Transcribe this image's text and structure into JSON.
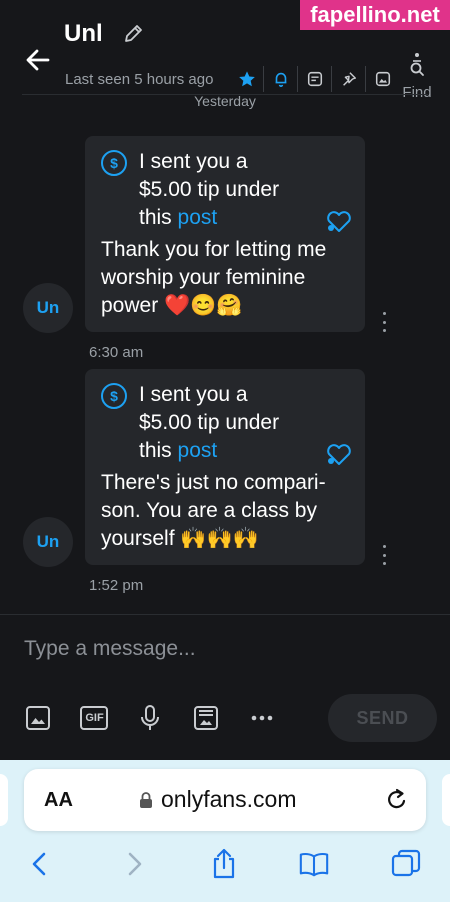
{
  "watermark": "fapellino.net",
  "header": {
    "name": "Unl",
    "last_seen": "Last seen 5 hours ago",
    "find_label": "Find",
    "icons": [
      "star-icon",
      "bell-icon",
      "note-icon",
      "pin-icon",
      "gallery-icon"
    ]
  },
  "day_divider": "Yesterday",
  "messages": [
    {
      "avatar": "Un",
      "tip_line1": "I sent you a",
      "tip_line2": "$5.00 tip under",
      "tip_line3": "this",
      "tip_link": "post",
      "text": "Thank you for letting me worship your feminine power ❤️😊🤗",
      "time": "6:30 am"
    },
    {
      "avatar": "Un",
      "tip_line1": "I sent you a",
      "tip_line2": "$5.00 tip under",
      "tip_line3": "this",
      "tip_link": "post",
      "text": "There's just no compari-son. You are a class by yourself 🙌🙌🙌",
      "time": "1:52 pm"
    }
  ],
  "composer": {
    "placeholder": "Type a message...",
    "send_label": "SEND",
    "tools": [
      "image-icon",
      "gif-icon",
      "microphone-icon",
      "vault-icon",
      "more-icon"
    ],
    "gif_label": "GIF"
  },
  "browser": {
    "aa_label": "AA",
    "url": "onlyfans.com"
  },
  "colors": {
    "accent": "#1da1f2",
    "background": "#16171a",
    "bubble": "#25272b",
    "browser_bg": "#ddf2f9",
    "heart": "#e0192d"
  }
}
